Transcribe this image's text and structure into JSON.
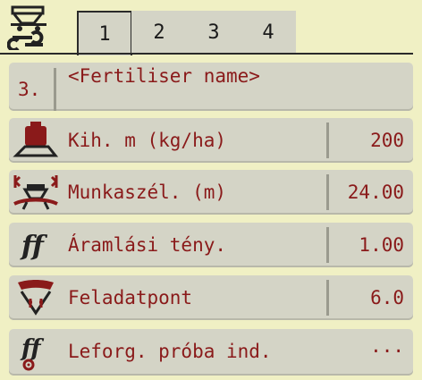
{
  "tabs": [
    {
      "label": "1",
      "active": true
    },
    {
      "label": "2",
      "active": false
    },
    {
      "label": "3",
      "active": false
    },
    {
      "label": "4",
      "active": false
    }
  ],
  "fertiliser": {
    "index": "3.",
    "name": "<Fertiliser name>"
  },
  "rows": [
    {
      "icon": "weight-icon",
      "label": "Kih. m (kg/ha)",
      "value": "200"
    },
    {
      "icon": "working-width-icon",
      "label": "Munkaszél. (m)",
      "value": "24.00"
    },
    {
      "icon": "flow-factor-icon",
      "label": "Áramlási tény.",
      "value": "1.00"
    },
    {
      "icon": "drop-point-icon",
      "label": "Feladatpont",
      "value": "6.0"
    },
    {
      "icon": "calibration-test-icon",
      "label": "Leforg. próba ind.",
      "value": "···"
    }
  ],
  "colors": {
    "background": "#f0f0c4",
    "panel": "#d4d4c6",
    "text": "#8a1a1a"
  }
}
